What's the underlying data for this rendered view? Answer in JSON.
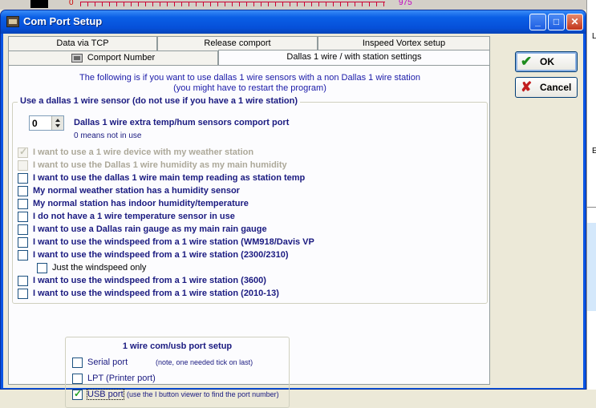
{
  "background": {
    "number_left": "0",
    "number_right": "975"
  },
  "window": {
    "title": "Com Port Setup"
  },
  "tabs": {
    "back": [
      "Data via TCP",
      "Release comport",
      "Inspeed Vortex setup"
    ],
    "front": [
      "Comport Number",
      "Dallas 1 wire / with station settings"
    ],
    "active": "Dallas 1 wire / with station settings"
  },
  "info": {
    "line1": "The following is if you want to use dallas 1 wire sensors with a non Dallas 1 wire station",
    "line2": "(you might have to restart the program)"
  },
  "sensor_group": {
    "title": "Use a dallas 1 wire sensor (do not use if you have a 1 wire station)",
    "comport_value": "0",
    "comport_label": "Dallas 1 wire extra temp/hum sensors comport port",
    "comport_hint": "0 means not in use",
    "options": [
      {
        "label": "I want to use a 1 wire device with my weather station",
        "checked": true,
        "disabled": true
      },
      {
        "label": "I want to use the Dallas 1 wire humidity as my main humidity",
        "checked": false,
        "disabled": true
      },
      {
        "label": "I want to use the dallas 1 wire main temp reading as station temp",
        "checked": false,
        "disabled": false
      },
      {
        "label": "My normal weather station has a humidity sensor",
        "checked": false,
        "disabled": false
      },
      {
        "label": "My normal station has indoor humidity/temperature",
        "checked": false,
        "disabled": false
      },
      {
        "label": "I do not have a 1 wire temperature sensor in use",
        "checked": false,
        "disabled": false
      },
      {
        "label": "I want to use a Dallas rain gauge as my main rain gauge",
        "checked": false,
        "disabled": false
      },
      {
        "label": "I want to use the windspeed from a 1 wire station (WM918/Davis VP",
        "checked": false,
        "disabled": false
      },
      {
        "label": "I want to use the windspeed from a 1 wire station (2300/2310)",
        "checked": false,
        "disabled": false
      },
      {
        "label": "Just the windspeed only",
        "checked": false,
        "disabled": false
      },
      {
        "label": "I want to use the windspeed from a 1 wire station (3600)",
        "checked": false,
        "disabled": false
      },
      {
        "label": "I want to use the windspeed from a 1 wire station (2010-13)",
        "checked": false,
        "disabled": false
      }
    ]
  },
  "port_group": {
    "title": "1 wire com/usb port setup",
    "options": [
      {
        "label": "Serial port",
        "note": "(note, one needed tick on last)",
        "checked": false
      },
      {
        "label": "LPT (Printer port)",
        "note": "",
        "checked": false
      },
      {
        "label": "USB port",
        "note": "(use the I button viewer to find the port number)",
        "checked": true
      }
    ]
  },
  "buttons": {
    "ok": "OK",
    "cancel": "Cancel"
  },
  "icons": {
    "ok": "check-icon",
    "cancel": "x-icon"
  }
}
